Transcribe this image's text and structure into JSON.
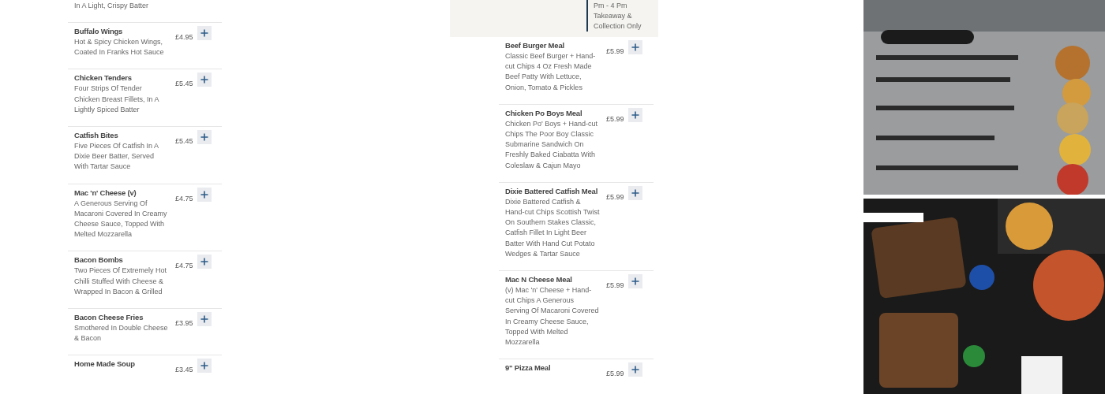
{
  "left_menu": {
    "items": [
      {
        "description": "In A Light, Crispy Batter"
      },
      {
        "name": "Buffalo Wings",
        "price": "£4.95",
        "description": "Hot & Spicy Chicken Wings, Coated In Franks Hot Sauce"
      },
      {
        "name": "Chicken Tenders",
        "price": "£5.45",
        "description": "Four Strips Of Tender Chicken Breast Fillets, In A Lightly Spiced Batter"
      },
      {
        "name": "Catfish Bites",
        "price": "£5.45",
        "description": "Five Pieces Of Catfish In A Dixie Beer Batter, Served With Tartar Sauce"
      },
      {
        "name": "Mac 'n' Cheese (v)",
        "price": "£4.75",
        "description": "A Generous Serving Of Macaroni Covered In Creamy Cheese Sauce, Topped With Melted Mozzarella"
      },
      {
        "name": "Bacon Bombs",
        "price": "£4.75",
        "description": "Two Pieces Of Extremely Hot Chilli Stuffed With Cheese & Wrapped In Bacon & Grilled"
      },
      {
        "name": "Bacon Cheese Fries",
        "price": "£3.95",
        "description": "Smothered In Double Cheese & Bacon"
      },
      {
        "name": "Home Made Soup",
        "price": "£3.45"
      }
    ]
  },
  "banner": {
    "lines": [
      "Pm - 4 Pm",
      "Takeaway &",
      "Collection Only"
    ]
  },
  "middle_menu": {
    "items": [
      {
        "name": "Beef Burger Meal",
        "price": "£5.99",
        "description": "Classic Beef Burger + Hand-cut Chips 4 Oz Fresh Made Beef Patty With Lettuce, Onion, Tomato & Pickles"
      },
      {
        "name": "Chicken Po Boys Meal",
        "price": "£5.99",
        "description": "Chicken Po' Boys + Hand-cut Chips The Poor Boy Classic Submarine Sandwich On Freshly Baked Ciabatta With Coleslaw & Cajun Mayo"
      },
      {
        "name": "Dixie Battered Catfish Meal",
        "price": "£5.99",
        "description": "Dixie Battered Catfish & Hand-cut Chips Scottish Twist On Southern Stakes Classic, Catfish Fillet In Light Beer Batter With Hand Cut Potato Wedges & Tartar Sauce"
      },
      {
        "name": "Mac N Cheese Meal",
        "price": "£5.99",
        "description": "(v) Mac 'n' Cheese + Hand-cut Chips A Generous Serving Of Macaroni Covered In Creamy Cheese Sauce, Topped With Melted Mozzarella"
      },
      {
        "name": "9\" Pizza Meal",
        "price": "£5.99"
      }
    ]
  }
}
